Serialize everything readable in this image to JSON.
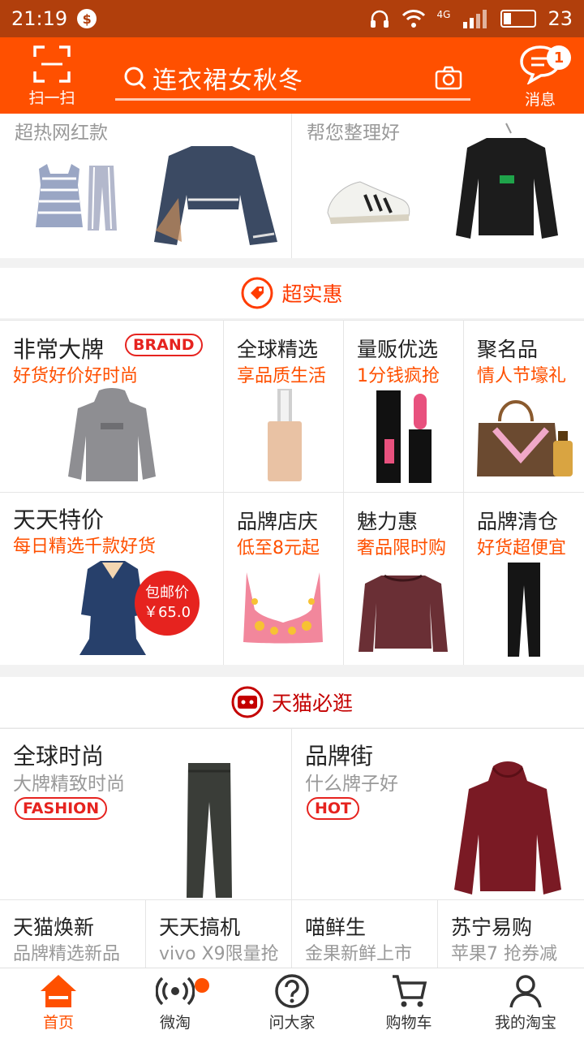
{
  "status": {
    "time": "21:19",
    "battery": "23",
    "network": "4G"
  },
  "header": {
    "scan_label": "扫一扫",
    "search_text": "连衣裙女秋冬",
    "message_label": "消息",
    "message_badge": "1"
  },
  "top_cards": [
    {
      "subtitle": "超热网红款"
    },
    {
      "subtitle": "帮您整理好"
    }
  ],
  "section_deals": {
    "title": "超实惠"
  },
  "deals": {
    "brand": {
      "title": "非常大牌",
      "tag": "BRAND",
      "subtitle": "好货好价好时尚"
    },
    "global": {
      "title": "全球精选",
      "subtitle": "享品质生活"
    },
    "bulk": {
      "title": "量贩优选",
      "subtitle": "1分钱疯抢"
    },
    "famous": {
      "title": "聚名品",
      "subtitle": "情人节壕礼"
    },
    "daily": {
      "title": "天天特价",
      "subtitle": "每日精选千款好货",
      "price_line1": "包邮价",
      "price_line2": "￥65.0"
    },
    "shop": {
      "title": "品牌店庆",
      "subtitle": "低至8元起"
    },
    "charm": {
      "title": "魅力惠",
      "subtitle": "奢品限时购"
    },
    "clear": {
      "title": "品牌清仓",
      "subtitle": "好货超便宜"
    }
  },
  "section_tmall": {
    "title": "天猫必逛"
  },
  "tmall": {
    "fashion": {
      "title": "全球时尚",
      "subtitle": "大牌精致时尚",
      "tag": "FASHION"
    },
    "street": {
      "title": "品牌街",
      "subtitle": "什么牌子好",
      "tag": "HOT"
    },
    "row": [
      {
        "title": "天猫焕新",
        "subtitle": "品牌精选新品"
      },
      {
        "title": "天天搞机",
        "subtitle": "vivo X9限量抢"
      },
      {
        "title": "喵鲜生",
        "subtitle": "金果新鲜上市"
      },
      {
        "title": "苏宁易购",
        "subtitle": "苹果7 抢券减"
      }
    ]
  },
  "nav": [
    {
      "label": "首页",
      "icon": "home-icon"
    },
    {
      "label": "微淘",
      "icon": "broadcast-icon"
    },
    {
      "label": "问大家",
      "icon": "question-icon"
    },
    {
      "label": "购物车",
      "icon": "cart-icon"
    },
    {
      "label": "我的淘宝",
      "icon": "user-icon"
    }
  ],
  "colors": {
    "brand": "#ff5000",
    "statusbar": "#b13f0c",
    "accent_red": "#e6231f"
  }
}
